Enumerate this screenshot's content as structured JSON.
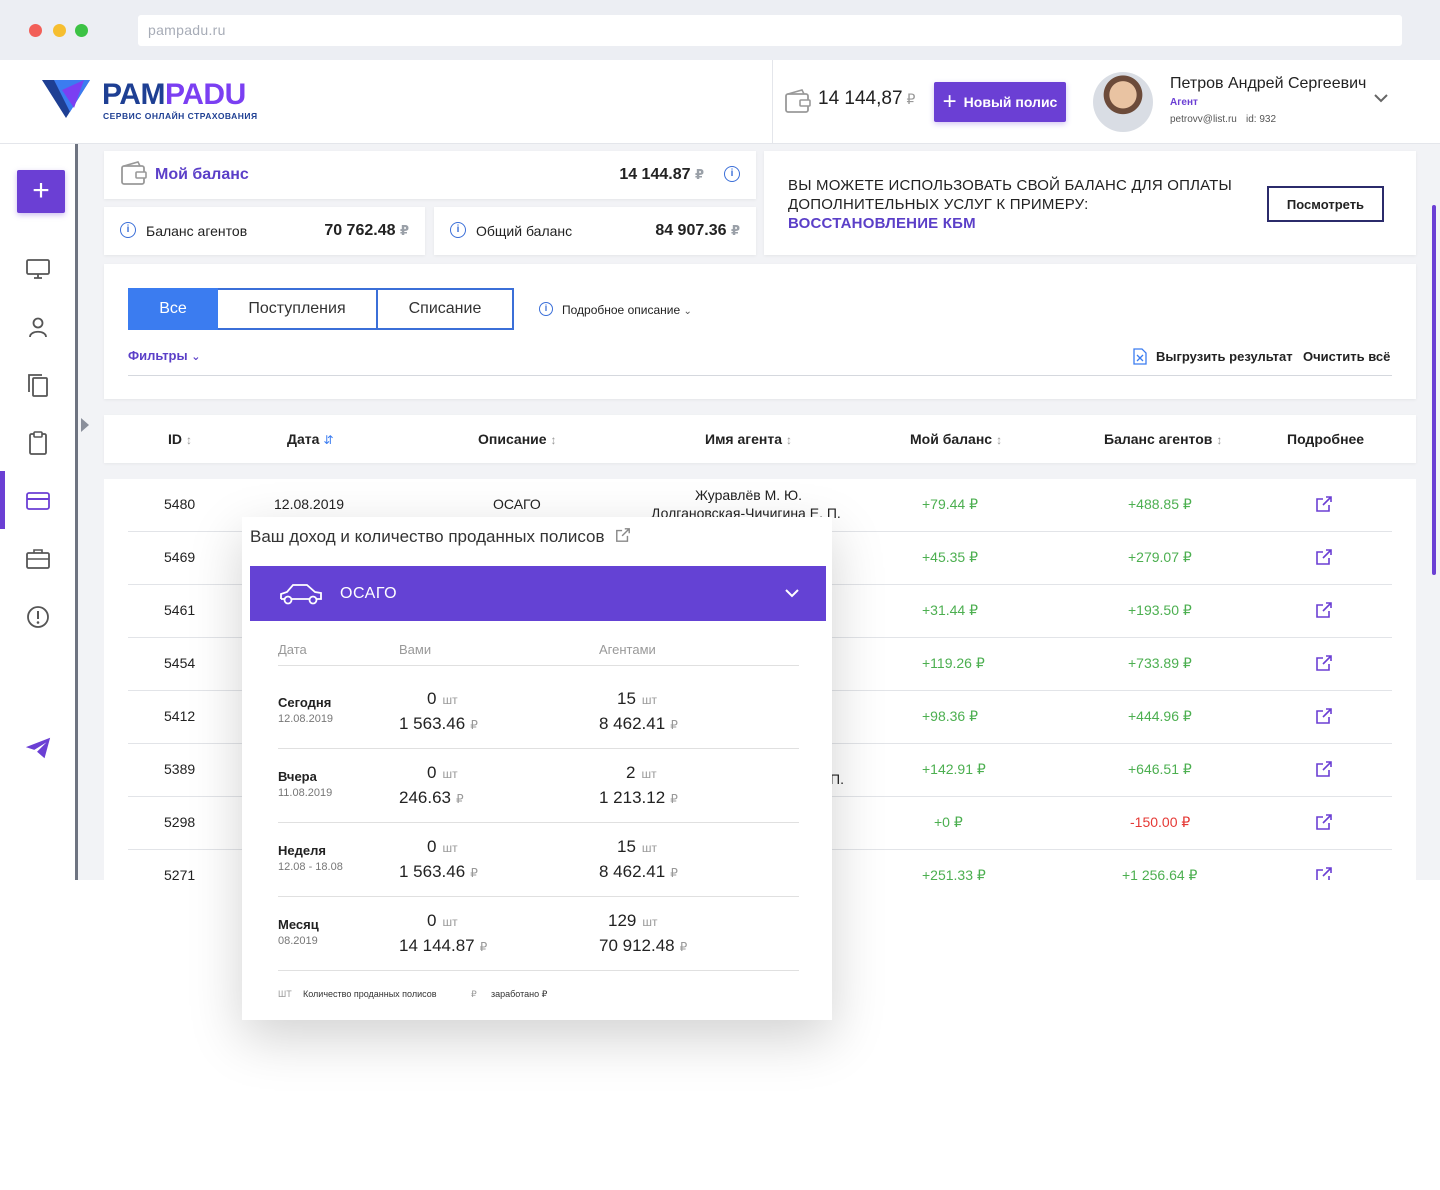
{
  "browser": {
    "url": "pampadu.ru"
  },
  "header": {
    "logo_pam": "PAM",
    "logo_padu": "PADU",
    "logo_sub": "СЕРВИС ОНЛАЙН СТРАХОВАНИЯ",
    "wallet_amount": "14 144,87",
    "wallet_currency": "₽",
    "new_policy": "Новый полис",
    "user_name": "Петров Андрей Сергеевич",
    "user_role": "Агент",
    "user_email": "petrovv@list.ru",
    "user_id": "id: 932"
  },
  "balance": {
    "my_label": "Мой баланс",
    "my_value": "14 144.87",
    "agents_label": "Баланс агентов",
    "agents_value": "70 762.48",
    "total_label": "Общий баланс",
    "total_value": "84 907.36",
    "currency": "₽"
  },
  "promo": {
    "line1": "ВЫ МОЖЕТЕ ИСПОЛЬЗОВАТЬ СВОЙ БАЛАНС ДЛЯ ОПЛАТЫ",
    "line2": "ДОПОЛНИТЕЛЬНЫХ УСЛУГ К ПРИМЕРУ:",
    "link": "ВОССТАНОВЛЕНИЕ КБМ",
    "button": "Посмотреть"
  },
  "filters": {
    "tabs": [
      "Все",
      "Поступления",
      "Списание"
    ],
    "detailed": "Подробное описание",
    "filters_label": "Фильтры",
    "export": "Выгрузить результат",
    "clear": "Очистить всё"
  },
  "table": {
    "columns": [
      "ID",
      "Дата",
      "Описание",
      "Имя агента",
      "Мой баланс",
      "Баланс агентов",
      "Подробнее"
    ],
    "rows": [
      {
        "id": "5480",
        "date": "12.08.2019",
        "desc": "ОСАГО",
        "agent1": "Журавлёв М. Ю.",
        "agent2": "Долгановская-Чичигина Е. П.",
        "my": "+79.44 ₽",
        "agents": "+488.85 ₽"
      },
      {
        "id": "5469",
        "my": "+45.35 ₽",
        "agents": "+279.07 ₽"
      },
      {
        "id": "5461",
        "my": "+31.44 ₽",
        "agents": "+193.50 ₽"
      },
      {
        "id": "5454",
        "my": "+119.26 ₽",
        "agents": "+733.89 ₽"
      },
      {
        "id": "5412",
        "my": "+98.36 ₽",
        "agents": "+444.96 ₽"
      },
      {
        "id": "5389",
        "agent_tail": "П.",
        "my": "+142.91 ₽",
        "agents": "+646.51 ₽"
      },
      {
        "id": "5298",
        "my": "+0 ₽",
        "agents": "-150.00 ₽"
      },
      {
        "id": "5271",
        "my": "+251.33 ₽",
        "agents": "+1 256.64 ₽"
      }
    ]
  },
  "popup": {
    "title": "Ваш доход и количество проданных полисов",
    "product": "ОСАГО",
    "col_date": "Дата",
    "col_you": "Вами",
    "col_agents": "Агентами",
    "unit": "шт",
    "currency": "₽",
    "rows": [
      {
        "label": "Сегодня",
        "date": "12.08.2019",
        "you_cnt": "0",
        "you_sum": "1 563.46",
        "ag_cnt": "15",
        "ag_sum": "8 462.41"
      },
      {
        "label": "Вчера",
        "date": "11.08.2019",
        "you_cnt": "0",
        "you_sum": "246.63",
        "ag_cnt": "2",
        "ag_sum": "1 213.12"
      },
      {
        "label": "Неделя",
        "date": "12.08 - 18.08",
        "you_cnt": "0",
        "you_sum": "1 563.46",
        "ag_cnt": "15",
        "ag_sum": "8 462.41"
      },
      {
        "label": "Месяц",
        "date": "08.2019",
        "you_cnt": "0",
        "you_sum": "14 144.87",
        "ag_cnt": "129",
        "ag_sum": "70 912.48"
      }
    ],
    "legend_unit": "ШТ",
    "legend_unit_text": "Количество проданных полисов",
    "legend_cur": "₽",
    "legend_cur_text": "заработано ₽"
  },
  "colors": {
    "accent": "#6b3fd4",
    "blue": "#3b7cf0",
    "positive": "#4caf50",
    "negative": "#e53935"
  }
}
